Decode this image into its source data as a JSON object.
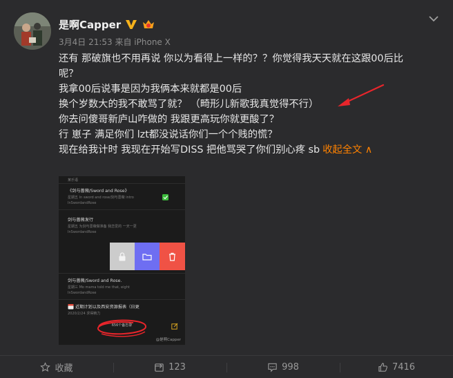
{
  "post": {
    "username": "是啊Capper",
    "meta": "3月4日 21:53 来自 iPhone X",
    "lines": [
      "还有 那破旗也不用再说 你以为看得上一样的？？你觉得我天天就在这跟00后比",
      "呢？",
      "我拿00后说事是因为我俩本来就都是00后",
      "换个岁数大的我不敢骂了就？ （畸形儿新歌我真觉得不行）",
      "你去问傻哥新庐山咋做的 我跟更高玩你就更酸了？",
      "行 崽子 满足你们 lzt都没说话你们一个个贱的慌？",
      "现在给我计时 我现在开始写DISS  把他骂哭了你们别心疼 sb"
    ],
    "collapse_label": "收起全文",
    "collapse_arrow": "∧"
  },
  "screenshot": {
    "top_label": "某乐语",
    "note1_title": "《剑与蔷薇/Sword and Rose》",
    "note1_sub": "星期五   In sword and rose/剑与蔷薇 intro",
    "note1_tag": "InSwordandRose",
    "note2_title": "剑与蔷薇发行",
    "note2_sub": "星期五   为剑与蔷薇做准备 我恋爱的  一天一更",
    "note2_tag": "InSwordandRose",
    "note3_title": "剑与蔷薇/Sword and Rose.",
    "note3_sub": "星期三   Mo mama told me that,   eight",
    "note3_tag": "InSwordandRose",
    "note4_title": "近期计划以及西安资源报表（日更",
    "note4_sub": "2020/2/24   求得精力",
    "count": "656个备忘录",
    "watermark": "@是啊Capper"
  },
  "actions": {
    "favorite": "收藏",
    "repost": "123",
    "comment": "998",
    "like": "7416"
  },
  "colors": {
    "accent": "#ff8200",
    "background": "#2b2b2d",
    "swipe_lock": "#cccccc",
    "swipe_folder": "#6e6ef2",
    "swipe_delete": "#f05245"
  }
}
